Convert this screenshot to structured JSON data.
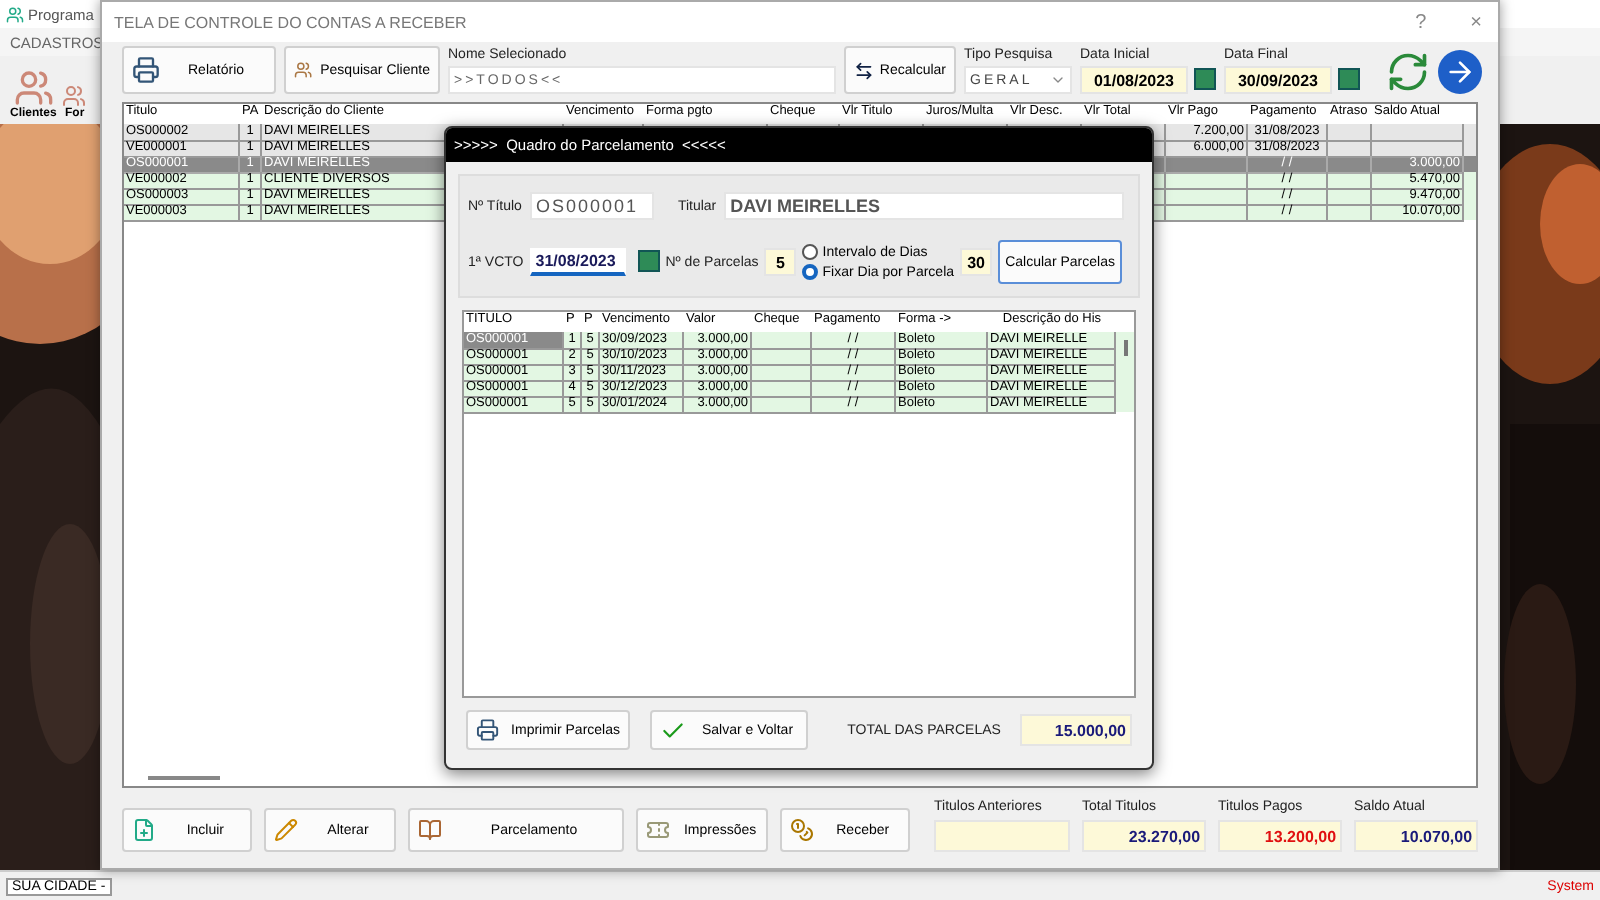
{
  "app": {
    "title": "Programa",
    "menu": [
      "CADASTROS"
    ],
    "toolbar": [
      {
        "label": "Clientes"
      },
      {
        "label": "For"
      }
    ],
    "status_bar": {
      "city": "SUA CIDADE -",
      "system": "System"
    }
  },
  "dialog": {
    "title": "TELA DE CONTROLE DO CONTAS A RECEBER",
    "help": "?",
    "close": "×",
    "toolbar": {
      "report_button": "Relatório",
      "search_client_button": "Pesquisar Cliente",
      "selected_name": {
        "label": "Nome Selecionado",
        "value": ">>TODOS<<"
      },
      "recalc_button": "Recalcular",
      "search_type": {
        "label": "Tipo  Pesquisa",
        "value": "GERAL"
      },
      "start_date": {
        "label": "Data Inicial",
        "value": "01/08/2023"
      },
      "end_date": {
        "label": "Data Final",
        "value": "30/09/2023"
      }
    },
    "table": {
      "columns": [
        "Titulo",
        "PA",
        "Descrição do Cliente",
        "Vencimento",
        "Forma pgto",
        "Cheque",
        "Vlr Titulo",
        "Juros/Multa",
        "Vlr Desc.",
        "Vlr Total",
        "Vlr Pago",
        "Pagamento",
        "Atraso",
        "Saldo Atual"
      ],
      "rows": [
        {
          "titulo": "OS000002",
          "pa": "1",
          "cliente": "DAVI MEIRELLES",
          "vlr_pago": "7.200,00",
          "pagamento": "31/08/2023",
          "paid": true,
          "selected": false
        },
        {
          "titulo": "VE000001",
          "pa": "1",
          "cliente": "DAVI MEIRELLES",
          "vlr_pago": "6.000,00",
          "pagamento": "31/08/2023",
          "paid": true,
          "selected": false
        },
        {
          "titulo": "OS000001",
          "pa": "1",
          "cliente": "DAVI MEIRELLES",
          "pagamento": "/ /",
          "saldo": "3.000,00",
          "paid": false,
          "selected": true
        },
        {
          "titulo": "VE000002",
          "pa": "1",
          "cliente": "CLIENTE DIVERSOS",
          "pagamento": "/ /",
          "saldo": "5.470,00",
          "paid": false,
          "selected": false
        },
        {
          "titulo": "OS000003",
          "pa": "1",
          "cliente": "DAVI MEIRELLES",
          "pagamento": "/ /",
          "saldo": "9.470,00",
          "paid": false,
          "selected": false
        },
        {
          "titulo": "VE000003",
          "pa": "1",
          "cliente": "DAVI MEIRELLES",
          "pagamento": "/ /",
          "saldo": "10.070,00",
          "paid": false,
          "selected": false
        }
      ]
    },
    "actions": [
      "Incluir",
      "Alterar",
      "Parcelamento",
      "Impressões",
      "Receber"
    ],
    "totals": [
      {
        "label": "Titulos Anteriores"
      },
      {
        "label": "Total Titulos",
        "value": "23.270,00",
        "alert": false
      },
      {
        "label": "Titulos Pagos",
        "value": "13.200,00",
        "alert": true
      },
      {
        "label": "Saldo Atual",
        "value": "10.070,00",
        "alert": false
      }
    ]
  },
  "modal": {
    "title": ">>>>>  Quadro do Parcelamento  <<<<<",
    "titulo": {
      "label": "Nº Título",
      "value": "OS000001"
    },
    "titular": {
      "label": "Titular",
      "value": "DAVI MEIRELLES"
    },
    "first_due": {
      "label": "1ª VCTO",
      "value": "31/08/2023"
    },
    "installments": {
      "label": "Nº de Parcelas",
      "value": "5"
    },
    "options": [
      {
        "label": "Intervalo de Dias",
        "selected": false
      },
      {
        "label": "Fixar Dia por Parcela",
        "selected": true
      }
    ],
    "day": "30",
    "calc_button": "Calcular Parcelas",
    "table": {
      "columns": [
        "TITULO",
        "P",
        "P",
        "Vencimento",
        "Valor",
        "Cheque",
        "Pagamento",
        "Forma ->",
        "Descrição do His"
      ],
      "rows": [
        {
          "titulo": "OS000001",
          "p": "1",
          "total": "5",
          "vencimento": "30/09/2023",
          "valor": "3.000,00",
          "pagamento": "/ /",
          "forma": "Boleto",
          "descricao": "DAVI MEIRELLE",
          "selected": true
        },
        {
          "titulo": "OS000001",
          "p": "2",
          "total": "5",
          "vencimento": "30/10/2023",
          "valor": "3.000,00",
          "pagamento": "/ /",
          "forma": "Boleto",
          "descricao": "DAVI MEIRELLE",
          "selected": false
        },
        {
          "titulo": "OS000001",
          "p": "3",
          "total": "5",
          "vencimento": "30/11/2023",
          "valor": "3.000,00",
          "pagamento": "/ /",
          "forma": "Boleto",
          "descricao": "DAVI MEIRELLE",
          "selected": false
        },
        {
          "titulo": "OS000001",
          "p": "4",
          "total": "5",
          "vencimento": "30/12/2023",
          "valor": "3.000,00",
          "pagamento": "/ /",
          "forma": "Boleto",
          "descricao": "DAVI MEIRELLE",
          "selected": false
        },
        {
          "titulo": "OS000001",
          "p": "5",
          "total": "5",
          "vencimento": "30/01/2024",
          "valor": "3.000,00",
          "pagamento": "/ /",
          "forma": "Boleto",
          "descricao": "DAVI MEIRELLE",
          "selected": false
        }
      ]
    },
    "print_button": "Imprimir  Parcelas",
    "save_button": "Salvar e Voltar",
    "total": {
      "label": "TOTAL DAS PARCELAS",
      "value": "15.000,00"
    }
  }
}
